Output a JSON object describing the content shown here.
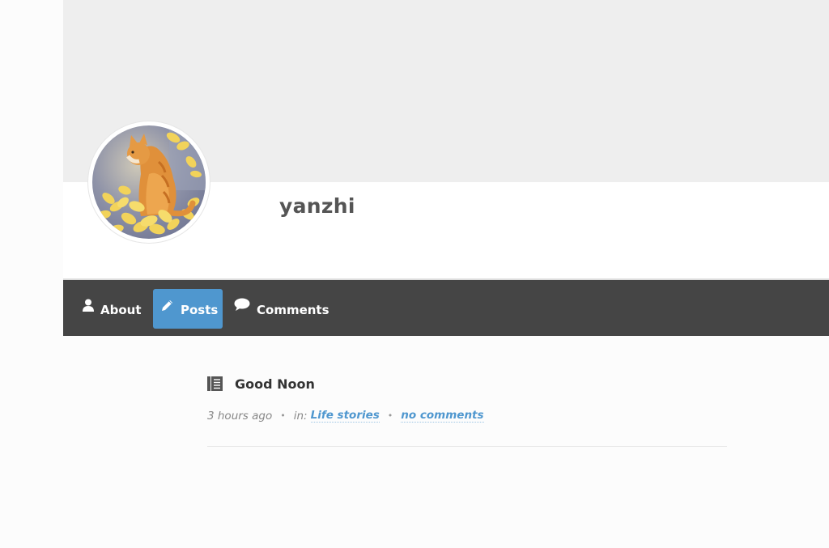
{
  "profile": {
    "username": "yanzhi",
    "avatar_alt": "cat-avatar"
  },
  "nav": {
    "items": [
      {
        "label": "About",
        "icon": "user-icon",
        "active": false
      },
      {
        "label": "Posts",
        "icon": "pencil-icon",
        "active": true
      },
      {
        "label": "Comments",
        "icon": "speech-bubble-icon",
        "active": false
      }
    ]
  },
  "post": {
    "icon": "document-icon",
    "title": "Good Noon",
    "time": "3 hours ago",
    "in_label": "in:",
    "category": "Life stories",
    "comments": "no comments"
  },
  "colors": {
    "accent": "#4f97cf",
    "navbar": "#454545",
    "cover": "#eeeeee"
  }
}
